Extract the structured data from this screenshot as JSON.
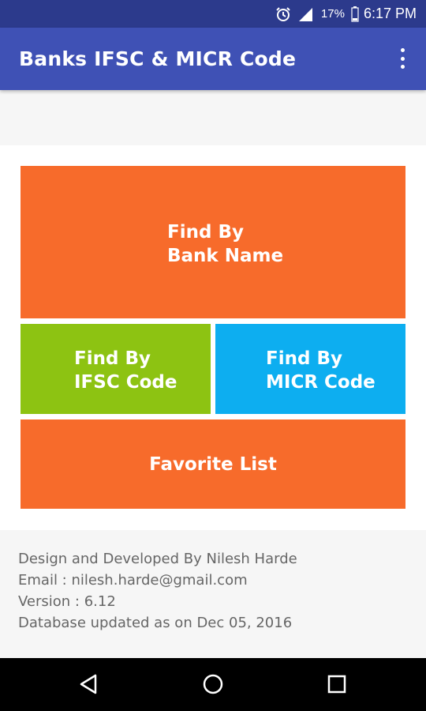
{
  "status_bar": {
    "battery": "17%",
    "time": "6:17 PM",
    "icons": [
      "alarm-icon",
      "signal-icon",
      "battery-icon"
    ]
  },
  "app_bar": {
    "title": "Banks IFSC & MICR Code",
    "overflow_icon": "more-vert-icon"
  },
  "tiles": {
    "bank": {
      "line1": "Find By",
      "line2": "Bank Name",
      "color": "#f76b2b"
    },
    "ifsc": {
      "line1": "Find By",
      "line2": "IFSC Code",
      "color": "#8dc312"
    },
    "micr": {
      "line1": "Find By",
      "line2": "MICR Code",
      "color": "#0daef0"
    },
    "favorite": {
      "label": "Favorite List",
      "color": "#f76b2b"
    }
  },
  "info": {
    "developer": "Design and Developed By Nilesh Harde",
    "email": "Email : nilesh.harde@gmail.com",
    "version": "Version : 6.12",
    "database": "Database updated as on Dec 05, 2016"
  },
  "colors": {
    "status_bar": "#2c3a8c",
    "app_bar": "#3f51b5"
  },
  "nav_bar": {
    "icons": [
      "back-icon",
      "home-icon",
      "recent-apps-icon"
    ]
  }
}
